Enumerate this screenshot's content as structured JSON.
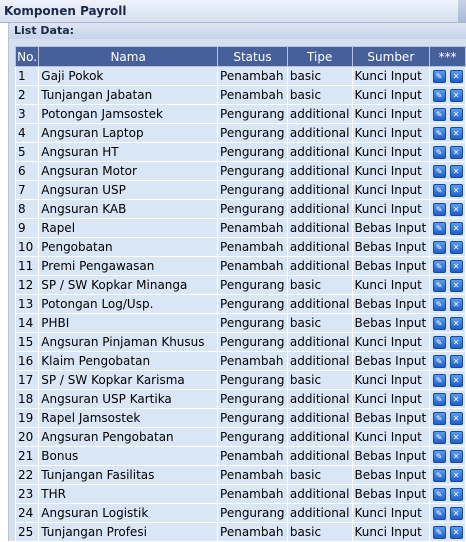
{
  "window": {
    "title": "Komponen Payroll"
  },
  "section": {
    "label": "List Data:"
  },
  "table": {
    "headers": {
      "no": "No.",
      "nama": "Nama",
      "status": "Status",
      "tipe": "Tipe",
      "sumber": "Sumber",
      "actions": "***"
    },
    "rows": [
      {
        "no": "1",
        "nama": "Gaji Pokok",
        "status": "Penambah",
        "tipe": "basic",
        "sumber": "Kunci Input"
      },
      {
        "no": "2",
        "nama": "Tunjangan Jabatan",
        "status": "Penambah",
        "tipe": "basic",
        "sumber": "Kunci Input"
      },
      {
        "no": "3",
        "nama": "Potongan Jamsostek",
        "status": "Pengurang",
        "tipe": "additional",
        "sumber": "Kunci Input"
      },
      {
        "no": "4",
        "nama": "Angsuran Laptop",
        "status": "Pengurang",
        "tipe": "additional",
        "sumber": "Kunci Input"
      },
      {
        "no": "5",
        "nama": "Angsuran HT",
        "status": "Pengurang",
        "tipe": "additional",
        "sumber": "Kunci Input"
      },
      {
        "no": "6",
        "nama": "Angsuran Motor",
        "status": "Pengurang",
        "tipe": "additional",
        "sumber": "Kunci Input"
      },
      {
        "no": "7",
        "nama": "Angsuran USP",
        "status": "Pengurang",
        "tipe": "additional",
        "sumber": "Kunci Input"
      },
      {
        "no": "8",
        "nama": "Angsuran KAB",
        "status": "Pengurang",
        "tipe": "additional",
        "sumber": "Kunci Input"
      },
      {
        "no": "9",
        "nama": "Rapel",
        "status": "Penambah",
        "tipe": "additional",
        "sumber": "Bebas Input"
      },
      {
        "no": "10",
        "nama": "Pengobatan",
        "status": "Penambah",
        "tipe": "additional",
        "sumber": "Bebas Input"
      },
      {
        "no": "11",
        "nama": "Premi Pengawasan",
        "status": "Penambah",
        "tipe": "additional",
        "sumber": "Bebas Input"
      },
      {
        "no": "12",
        "nama": "SP / SW Kopkar Minanga",
        "status": "Pengurang",
        "tipe": "basic",
        "sumber": "Kunci Input"
      },
      {
        "no": "13",
        "nama": "Potongan Log/Usp.",
        "status": "Pengurang",
        "tipe": "additional",
        "sumber": "Bebas Input"
      },
      {
        "no": "14",
        "nama": "PHBI",
        "status": "Pengurang",
        "tipe": "basic",
        "sumber": "Bebas Input"
      },
      {
        "no": "15",
        "nama": "Angsuran Pinjaman Khusus",
        "status": "Pengurang",
        "tipe": "additional",
        "sumber": "Kunci Input"
      },
      {
        "no": "16",
        "nama": "Klaim Pengobatan",
        "status": "Penambah",
        "tipe": "additional",
        "sumber": "Bebas Input"
      },
      {
        "no": "17",
        "nama": "SP / SW Kopkar Karisma",
        "status": "Pengurang",
        "tipe": "basic",
        "sumber": "Kunci Input"
      },
      {
        "no": "18",
        "nama": "Angsuran USP Kartika",
        "status": "Pengurang",
        "tipe": "additional",
        "sumber": "Kunci Input"
      },
      {
        "no": "19",
        "nama": "Rapel Jamsostek",
        "status": "Pengurang",
        "tipe": "additional",
        "sumber": "Bebas Input"
      },
      {
        "no": "20",
        "nama": "Angsuran Pengobatan",
        "status": "Pengurang",
        "tipe": "additional",
        "sumber": "Kunci Input"
      },
      {
        "no": "21",
        "nama": "Bonus",
        "status": "Penambah",
        "tipe": "additional",
        "sumber": "Bebas Input"
      },
      {
        "no": "22",
        "nama": "Tunjangan Fasilitas",
        "status": "Penambah",
        "tipe": "basic",
        "sumber": "Bebas Input"
      },
      {
        "no": "23",
        "nama": "THR",
        "status": "Penambah",
        "tipe": "additional",
        "sumber": "Bebas Input"
      },
      {
        "no": "24",
        "nama": "Angsuran Logistik",
        "status": "Pengurang",
        "tipe": "additional",
        "sumber": "Kunci Input"
      },
      {
        "no": "25",
        "nama": "Tunjangan Profesi",
        "status": "Penambah",
        "tipe": "basic",
        "sumber": "Kunci Input"
      }
    ]
  },
  "icons": {
    "edit": "wrench-icon",
    "delete": "close-icon"
  },
  "colors": {
    "header_bg": "#45609a",
    "row_bg": "#d9e6f6",
    "panel_bg": "#d4dff0",
    "button": "#2f6fd6"
  }
}
